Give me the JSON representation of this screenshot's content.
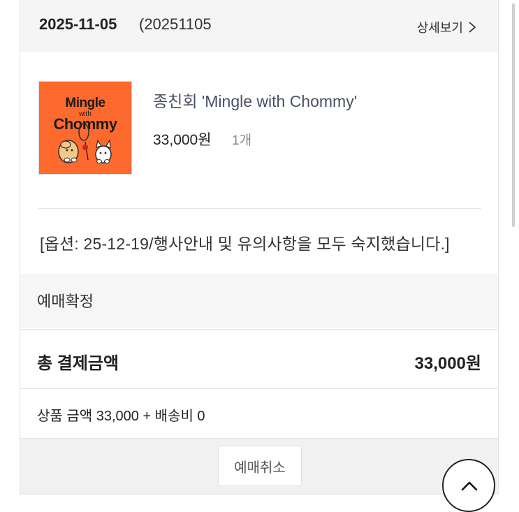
{
  "header": {
    "order_date": "2025-11-05",
    "order_number": "(20251105",
    "detail_label": "상세보기"
  },
  "product": {
    "thumbnail": {
      "line1": "Mingle",
      "line2": "with",
      "line3": "Chommy"
    },
    "name": "종친회 'Mingle with Chommy'",
    "price": "33,000원",
    "quantity": "1개"
  },
  "option": "[옵션: 25-12-19/행사안내 및 유의사항을 모두 숙지했습니다.]",
  "status": "예매확정",
  "total": {
    "label": "총 결제금액",
    "amount": "33,000원"
  },
  "breakdown": "상품 금액 33,000 + 배송비 0",
  "footer": {
    "cancel_label": "예매취소"
  },
  "colors": {
    "thumbnail_bg": "#fe6a2d",
    "product_name": "#4a4f66",
    "header_bg": "#f5f5f5"
  }
}
